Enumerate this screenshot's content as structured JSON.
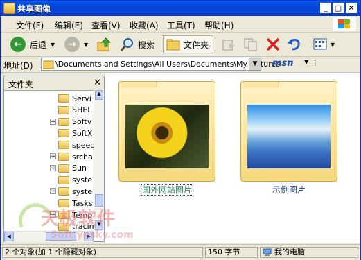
{
  "window": {
    "title": "共享图像"
  },
  "menu": [
    "文件(F)",
    "编辑(E)",
    "查看(V)",
    "收藏(A)",
    "工具(T)",
    "帮助(H)"
  ],
  "toolbar": {
    "back": "后退",
    "search": "搜索",
    "folders": "文件夹"
  },
  "address": {
    "label": "地址(D)",
    "value": "\\Documents and Settings\\All Users\\Documents\\My Pictures",
    "brand": "msn"
  },
  "sidebar": {
    "title": "文件夹",
    "items": [
      {
        "label": "Servi",
        "expander": false
      },
      {
        "label": "SHEL",
        "expander": false
      },
      {
        "label": "Softv",
        "expander": true
      },
      {
        "label": "SoftX",
        "expander": false
      },
      {
        "label": "speed",
        "expander": false
      },
      {
        "label": "srcha",
        "expander": true
      },
      {
        "label": "Sun",
        "expander": true
      },
      {
        "label": "syste",
        "expander": false
      },
      {
        "label": "syste",
        "expander": true
      },
      {
        "label": "Tasks",
        "expander": false
      },
      {
        "label": "Temp",
        "expander": true
      },
      {
        "label": "tracin",
        "expander": false
      }
    ]
  },
  "folders": [
    {
      "name": "国外网站图片",
      "image": "sunflower-bee",
      "selected": true
    },
    {
      "name": "示例图片",
      "image": "blue-mountains",
      "selected": false
    }
  ],
  "status": {
    "objects": "2 个对象(加 1 个隐藏对象)",
    "size": "150 字节",
    "location": "我的电脑"
  },
  "watermark": {
    "brand": "天极软件",
    "domain": "Soft.yesky.com"
  },
  "colors": {
    "titlebar": "#0343d6",
    "selection": "#2f8f5c"
  }
}
